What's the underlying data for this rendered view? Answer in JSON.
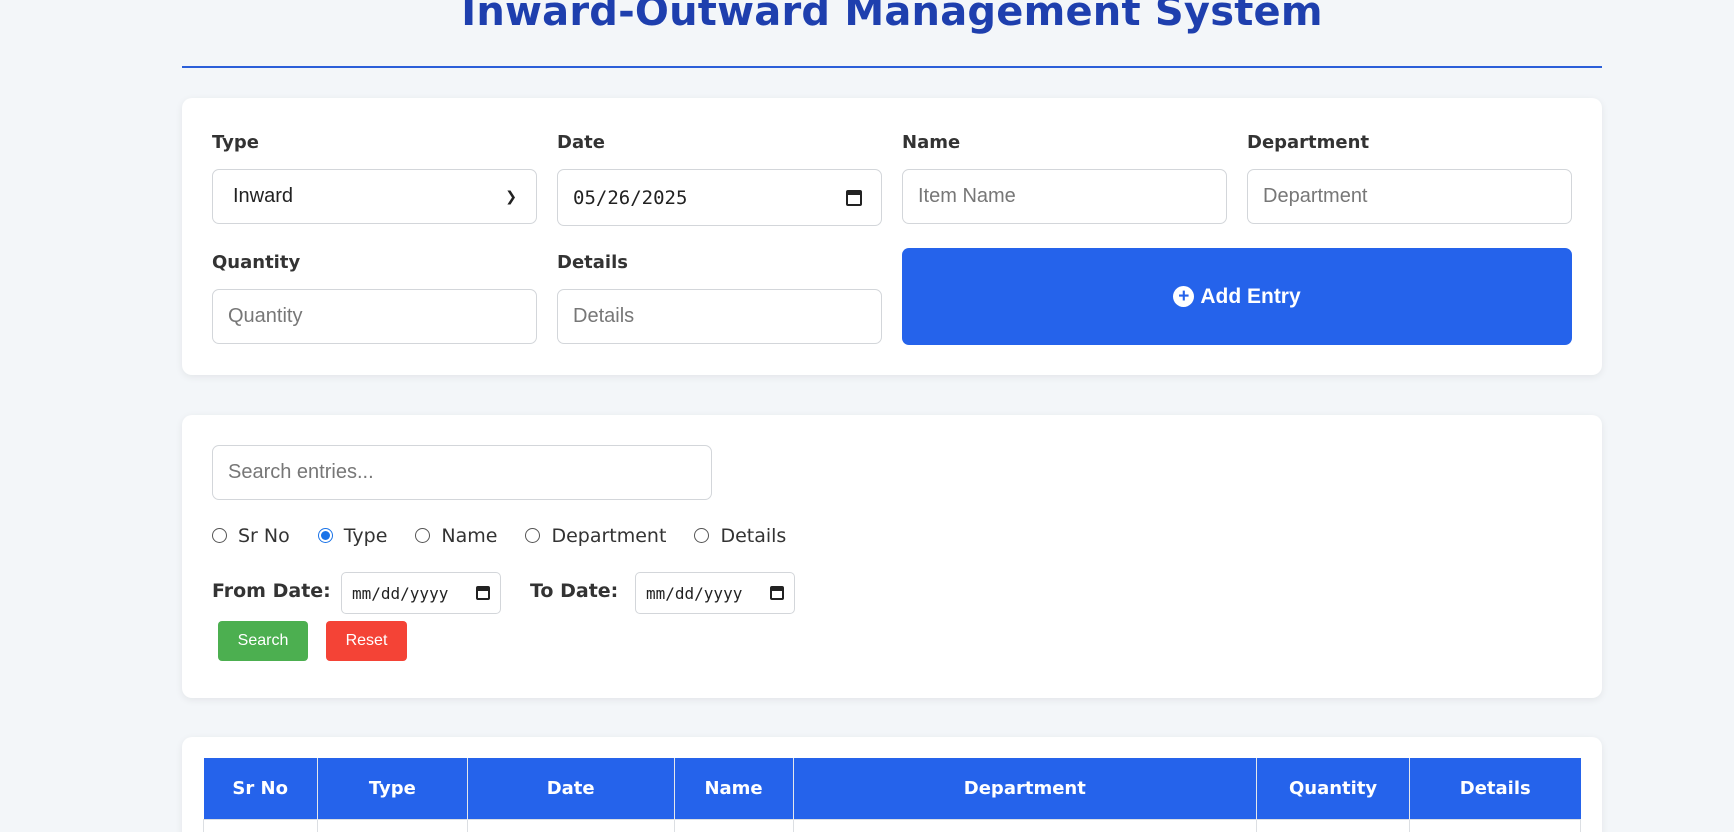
{
  "header": {
    "title": "Inward-Outward Management System"
  },
  "entry_form": {
    "type": {
      "label": "Type",
      "value": "Inward"
    },
    "date": {
      "label": "Date",
      "value": "05/26/2025"
    },
    "name": {
      "label": "Name",
      "placeholder": "Item Name"
    },
    "department": {
      "label": "Department",
      "placeholder": "Department"
    },
    "quantity": {
      "label": "Quantity",
      "placeholder": "Quantity"
    },
    "details": {
      "label": "Details",
      "placeholder": "Details"
    },
    "add_button": "Add Entry"
  },
  "search": {
    "placeholder": "Search entries...",
    "radios": [
      {
        "label": "Sr No",
        "checked": false
      },
      {
        "label": "Type",
        "checked": true
      },
      {
        "label": "Name",
        "checked": false
      },
      {
        "label": "Department",
        "checked": false
      },
      {
        "label": "Details",
        "checked": false
      }
    ],
    "from_label": "From Date:",
    "to_label": "To Date:",
    "from_value": "mm/dd/yyyy",
    "to_value": "mm/dd/yyyy",
    "search_button": "Search",
    "reset_button": "Reset"
  },
  "table": {
    "columns": [
      "Sr No",
      "Type",
      "Date",
      "Name",
      "Department",
      "Quantity",
      "Details"
    ]
  },
  "colors": {
    "primary": "#2563eb",
    "title": "#1e3fae",
    "search_button": "#4caf50",
    "reset_button": "#f44336"
  }
}
